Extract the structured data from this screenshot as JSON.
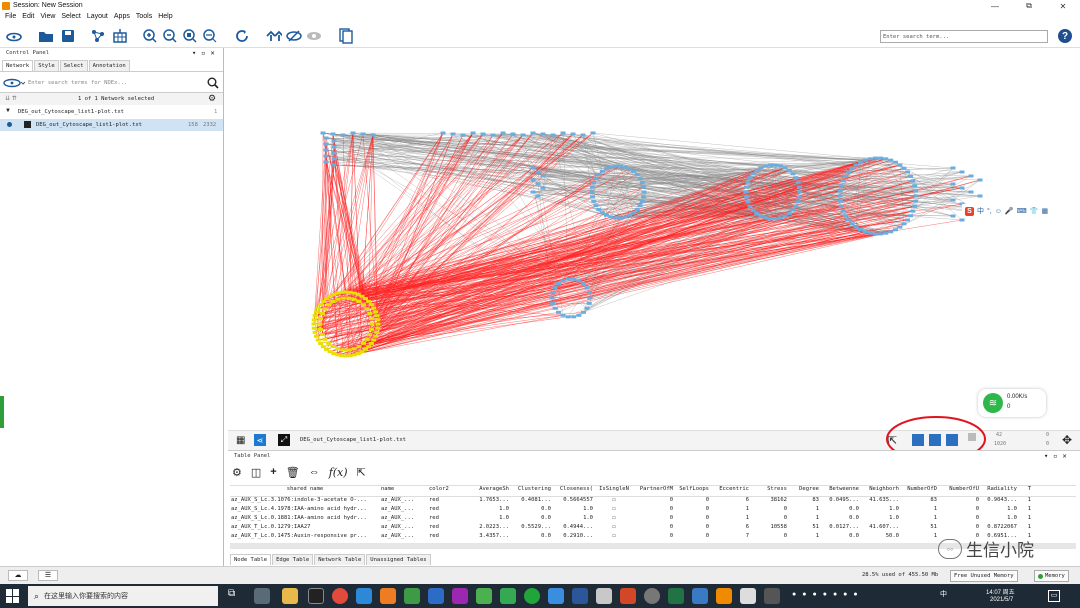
{
  "window": {
    "title": "Session: New Session",
    "controls": [
      "—",
      "⧉",
      "✕"
    ]
  },
  "menu": [
    "File",
    "Edit",
    "View",
    "Select",
    "Layout",
    "Apps",
    "Tools",
    "Help"
  ],
  "toolbar": {
    "search_placeholder": "Enter search term...",
    "help_label": "?"
  },
  "control_panel": {
    "title": "Control Panel",
    "tabs": [
      "Network",
      "Style",
      "Select",
      "Annotation"
    ],
    "search_placeholder": "Enter search terms for NDEx...",
    "selection_status": "1 of 1 Network selected",
    "collection_name": "DEG_out_Cytoscape_list1-plot.txt",
    "collection_count": "1",
    "network_name": "DEG_out_Cytoscape_list1-plot.txt",
    "network_nodes": "158",
    "network_edges": "2332"
  },
  "view_bar": {
    "network_label": "DEG_out_Cytoscape_list1-plot.txt",
    "counts_top_left": "42",
    "counts_top_right": "0",
    "counts_bottom_left": "1020",
    "counts_bottom_right": "0"
  },
  "speed_widget": {
    "upload": "0.00K/s",
    "download": "0"
  },
  "ime_bar": "中",
  "table_panel": {
    "title": "Table Panel",
    "formula_icon": "f(x)",
    "columns": [
      "shared name",
      "name",
      "color2",
      "AverageSh",
      "Clustering",
      "Closeness(",
      "IsSingleN",
      "PartnerOfM",
      "SelfLoops",
      "Eccentric",
      "Stress",
      "Degree",
      "Betweenne",
      "Neighborh",
      "NumberOfD",
      "NumberOfU",
      "Radiality",
      "T"
    ],
    "rows": [
      [
        "az_AUX_S_Lc.3.1076:indole-3-acetate O-...",
        "az_AUX_...",
        "red",
        "1.7653...",
        "0.4081...",
        "0.5664557",
        "☐",
        "0",
        "0",
        "6",
        "38162",
        "83",
        "0.0495...",
        "41.635...",
        "83",
        "0",
        "0.9043...",
        "1"
      ],
      [
        "az_AUX_S_Lc.4.1978:IAA-amino acid hydr...",
        "az_AUX_...",
        "red",
        "1.0",
        "0.0",
        "1.0",
        "☐",
        "0",
        "0",
        "1",
        "0",
        "1",
        "0.0",
        "1.0",
        "1",
        "0",
        "1.0",
        "1"
      ],
      [
        "az_AUX_S_Lc.0.1881:IAA-amino acid hydr...",
        "az_AUX_...",
        "red",
        "1.0",
        "0.0",
        "1.0",
        "☐",
        "0",
        "0",
        "1",
        "0",
        "1",
        "0.0",
        "1.0",
        "1",
        "0",
        "1.0",
        "1"
      ],
      [
        "az_AUX_T_Lc.0.1279:IAA27",
        "az_AUX_...",
        "red",
        "2.0223...",
        "0.5529...",
        "0.4944...",
        "☐",
        "0",
        "0",
        "6",
        "10558",
        "51",
        "0.0127...",
        "41.607...",
        "51",
        "0",
        "0.8722067",
        "1"
      ],
      [
        "az_AUX_T_Lc.0.1475:Auxin-responsive pr...",
        "az_AUX_...",
        "red",
        "3.4357...",
        "0.0",
        "0.2910...",
        "☐",
        "0",
        "0",
        "7",
        "0",
        "1",
        "0.0",
        "50.0",
        "1",
        "0",
        "0.6951...",
        "1"
      ]
    ],
    "tabs": [
      "Node Table",
      "Edge Table",
      "Network Table",
      "Unassigned Tables"
    ]
  },
  "status": {
    "memory_text": "28.5% used of 455.50 Mb",
    "free_memory": "Free Unused Memory",
    "memory_label": "Memory"
  },
  "taskbar": {
    "search_placeholder": "在这里输入你要搜索的内容",
    "time": "14:07 周五",
    "date": "2021/5/7",
    "input_indicator": "中"
  },
  "watermark": "生信小院",
  "colors": {
    "node_blue": "#6aaee0",
    "node_yellow": "#e8e000",
    "edge_red": "#ff2020",
    "edge_gray": "#8a8a8a",
    "annotation_red": "#e0141e",
    "memory_green": "#2e9e3a"
  }
}
